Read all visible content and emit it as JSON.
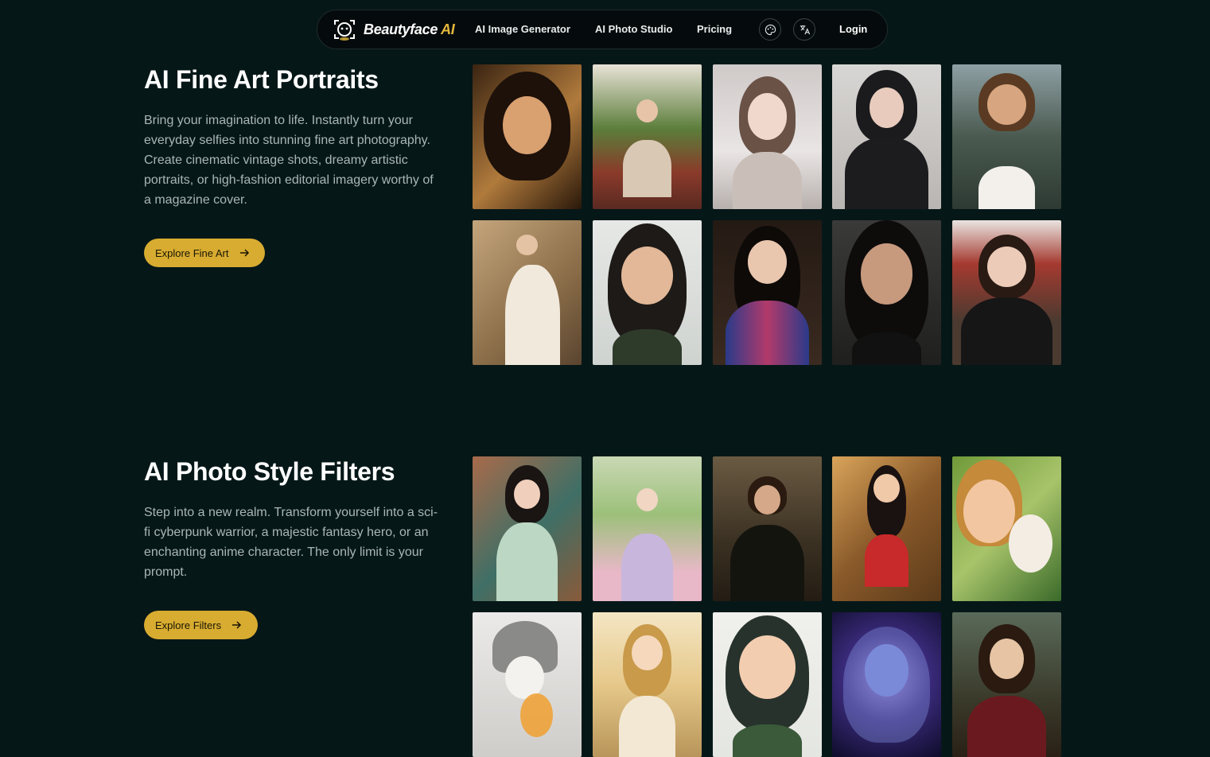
{
  "nav": {
    "brand_main": "Beautyface",
    "brand_accent": "AI",
    "links": [
      "AI Image Generator",
      "AI Photo Studio",
      "Pricing"
    ],
    "login": "Login",
    "icons": [
      "palette-icon",
      "translate-icon"
    ]
  },
  "sections": [
    {
      "title": "AI Fine Art Portraits",
      "description": "Bring your imagination to life. Instantly turn your everyday selfies into stunning fine art photography. Create cinematic vintage shots, dreamy artistic portraits, or high-fashion editorial imagery worthy of a magazine cover.",
      "button": "Explore Fine Art"
    },
    {
      "title": "AI Photo Style Filters",
      "description": "Step into a new realm. Transform yourself into a sci-fi cyberpunk warrior, a majestic fantasy hero, or an enchanting anime character. The only limit is your prompt.",
      "button": "Explore Filters"
    }
  ],
  "colors": {
    "background": "#061718",
    "accent": "#d8ac30",
    "brand_ai": "#e5b93d"
  }
}
